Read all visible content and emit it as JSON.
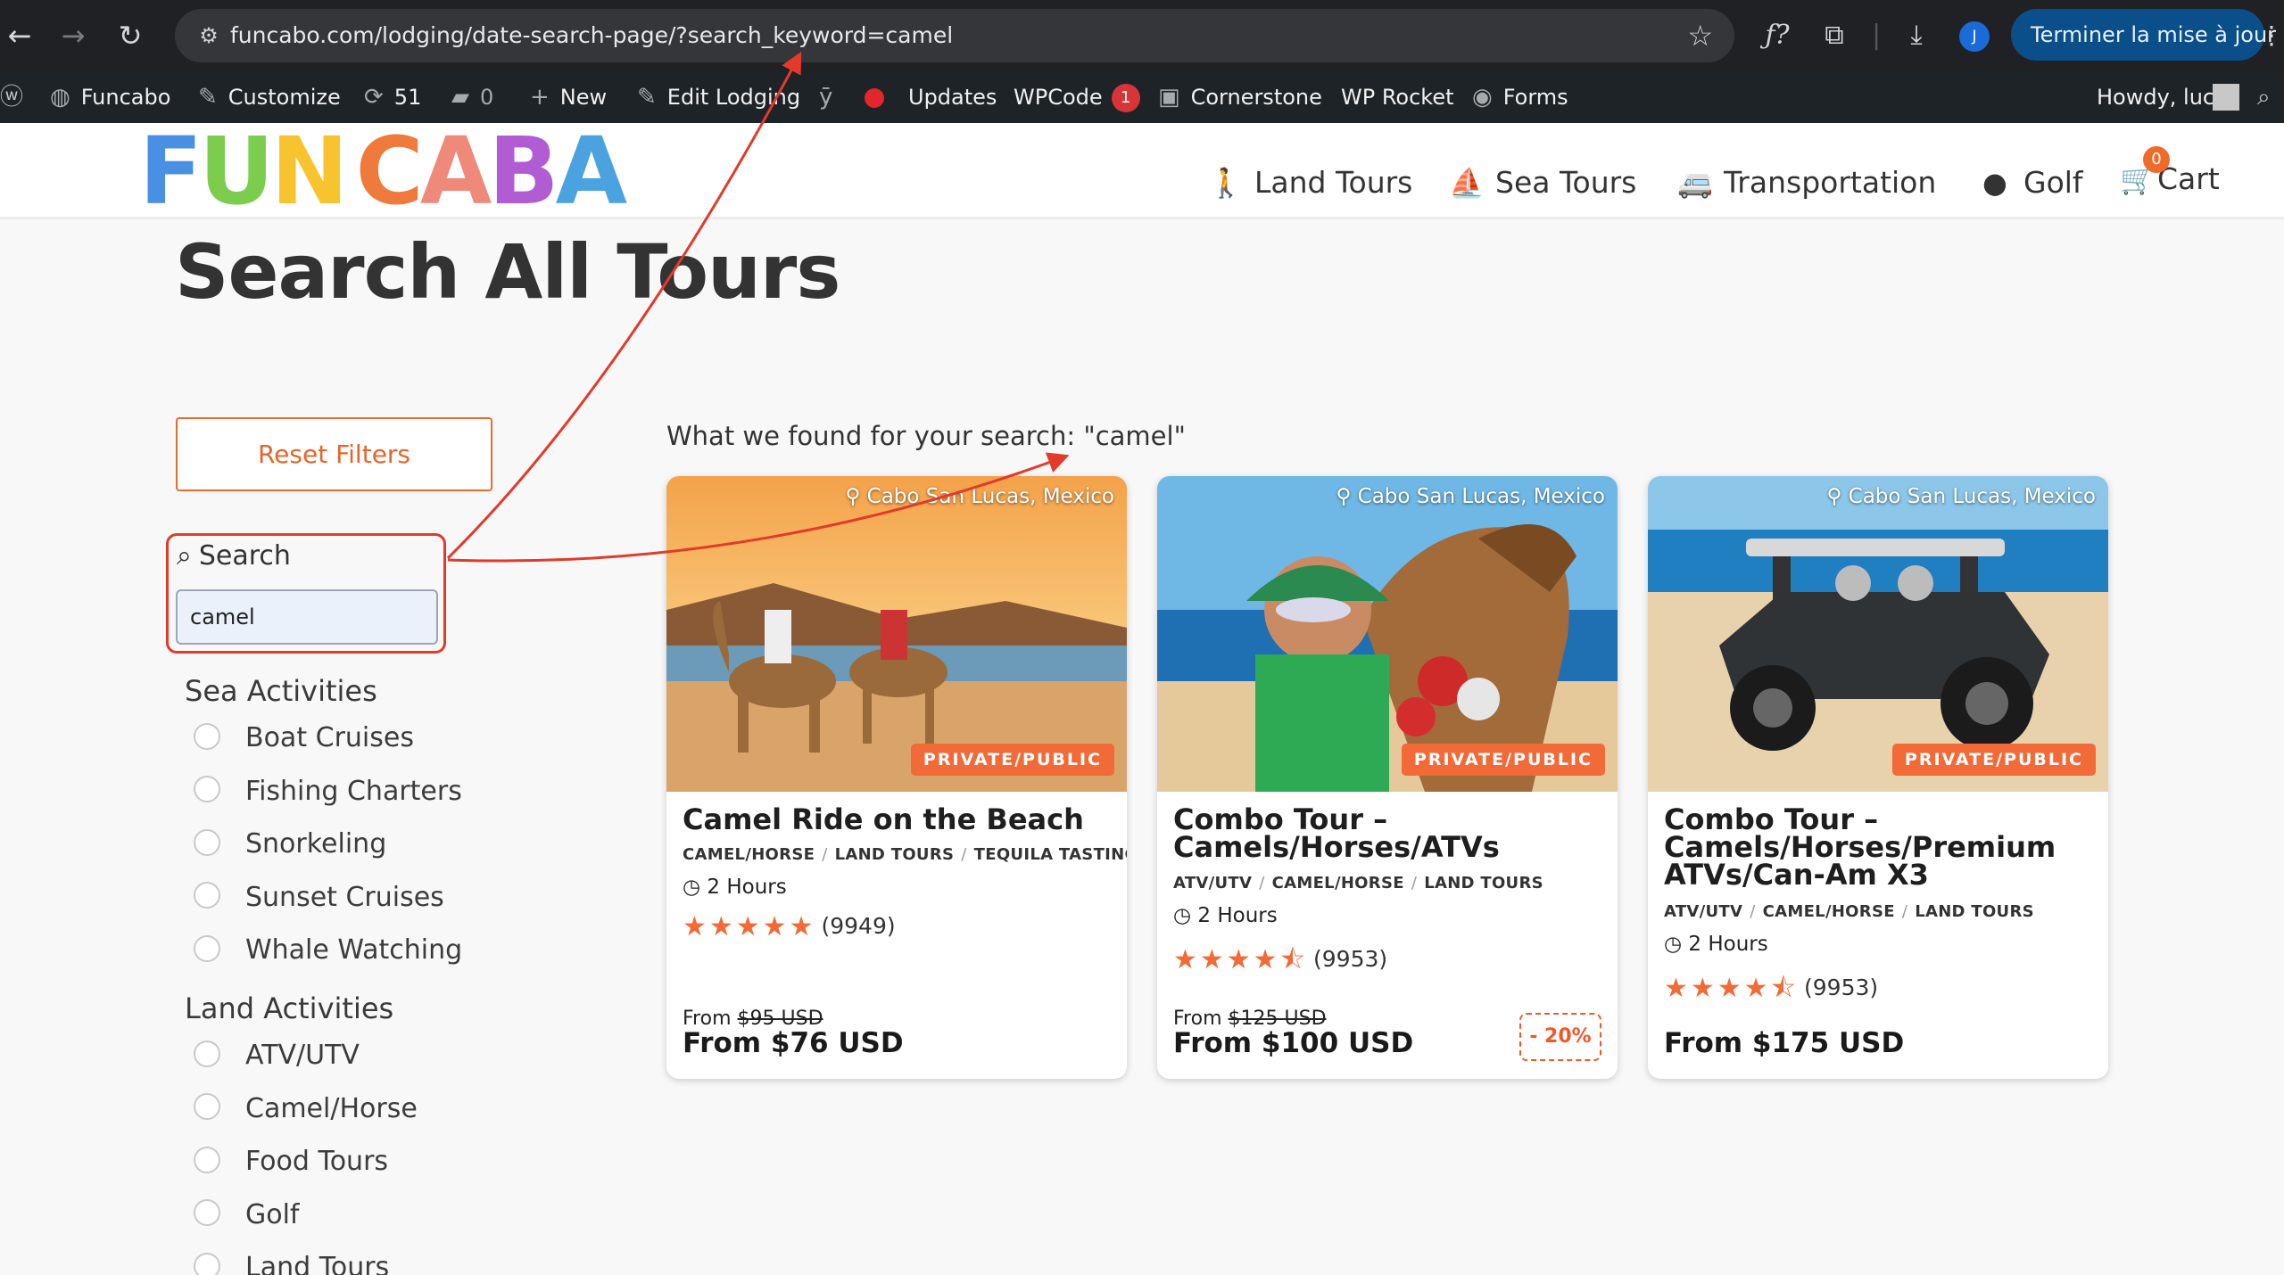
{
  "browser": {
    "url": "funcabo.com/lodging/date-search-page/?search_keyword=camel",
    "profile_initial": "J",
    "update_button": "Terminer la mise à jour"
  },
  "admin_bar": {
    "site_name": "Funcabo",
    "customize": "Customize",
    "updates_count": "51",
    "comments_count": "0",
    "new": "New",
    "edit_lodging": "Edit Lodging",
    "updates": "Updates",
    "wpcode": "WPCode",
    "wpcode_badge": "1",
    "cornerstone": "Cornerstone",
    "wp_rocket": "WP Rocket",
    "forms": "Forms",
    "howdy": "Howdy, luc"
  },
  "site": {
    "logo_letters": [
      "F",
      "U",
      "N",
      " ",
      "C",
      "A",
      "B",
      "A"
    ],
    "logo_colors": [
      "#4a90e2",
      "#7ccd4e",
      "#f7c430",
      "#ffffff",
      "#f07a3c",
      "#ef8a7a",
      "#b25cd4",
      "#4aa3df"
    ],
    "nav": [
      {
        "label": "Land Tours",
        "icon": "hiker-icon"
      },
      {
        "label": "Sea Tours",
        "icon": "sailboat-icon"
      },
      {
        "label": "Transportation",
        "icon": "shuttle-icon"
      },
      {
        "label": "Golf",
        "icon": "golf-ball-icon"
      },
      {
        "label": "Cart",
        "icon": "cart-icon"
      }
    ],
    "cart_count": "0"
  },
  "page": {
    "title": "Search All Tours",
    "reset_filters": "Reset Filters",
    "search_label": "Search",
    "search_value": "camel",
    "results_text": "What we found for your search: \"camel\""
  },
  "filters": {
    "sea_heading": "Sea Activities",
    "sea": [
      "Boat Cruises",
      "Fishing Charters",
      "Snorkeling",
      "Sunset Cruises",
      "Whale Watching"
    ],
    "land_heading": "Land Activities",
    "land": [
      "ATV/UTV",
      "Camel/Horse",
      "Food Tours",
      "Golf",
      "Land Tours"
    ]
  },
  "cards": [
    {
      "location": "Cabo San Lucas, Mexico",
      "badge": "PRIVATE/PUBLIC",
      "title": "Camel Ride on the Beach",
      "categories": [
        "CAMEL/HORSE",
        "LAND TOURS",
        "TEQUILA TASTING"
      ],
      "duration": "2 Hours",
      "stars": "★★★★★",
      "rating": 5,
      "reviews": "(9949)",
      "from_label": "From",
      "old_price": "$95 USD",
      "price": "From $76 USD",
      "discount": ""
    },
    {
      "location": "Cabo San Lucas, Mexico",
      "badge": "PRIVATE/PUBLIC",
      "title": "Combo Tour – Camels/Horses/ATVs",
      "categories": [
        "ATV/UTV",
        "CAMEL/HORSE",
        "LAND TOURS"
      ],
      "duration": "2 Hours",
      "stars": "★★★★⯪",
      "rating": 4.5,
      "reviews": "(9953)",
      "from_label": "From",
      "old_price": "$125 USD",
      "price": "From $100 USD",
      "discount": "- 20%"
    },
    {
      "location": "Cabo San Lucas, Mexico",
      "badge": "PRIVATE/PUBLIC",
      "title": "Combo Tour – Camels/Horses/Premium ATVs/Can-Am X3",
      "categories": [
        "ATV/UTV",
        "CAMEL/HORSE",
        "LAND TOURS"
      ],
      "duration": "2 Hours",
      "stars": "★★★★⯪",
      "rating": 4.5,
      "reviews": "(9953)",
      "from_label": "",
      "old_price": "",
      "price": "From $175 USD",
      "discount": ""
    }
  ],
  "colors": {
    "accent": "#f26a37",
    "annotation": "#e23a2b",
    "admin_bar": "#1d2327",
    "browser": "#202124"
  }
}
